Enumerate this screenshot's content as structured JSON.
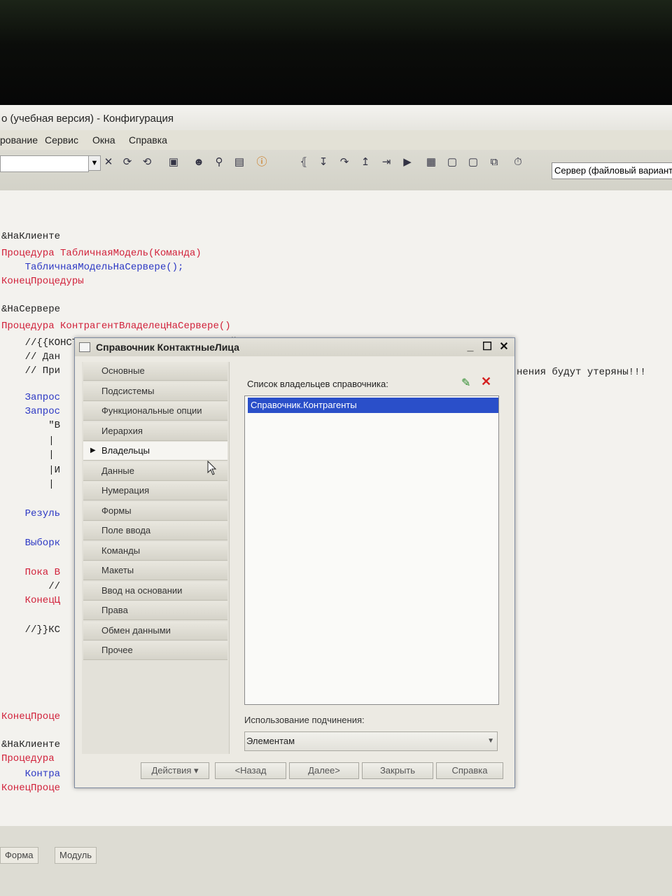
{
  "window": {
    "title": "о (учебная версия) - Конфигурация"
  },
  "menu": {
    "items": [
      "рование",
      "Сервис",
      "Окна",
      "Справка"
    ]
  },
  "toolbar": {
    "server_mode": "Сервер (файловый вариант"
  },
  "code": {
    "lines": [
      {
        "t": "&НаКлиенте",
        "c": "cm"
      },
      {
        "t": "Процедура ТабличнаяМодель(Команда)",
        "c": "kw"
      },
      {
        "t": "    ТабличнаяМодельНаСервере();",
        "c": "fn"
      },
      {
        "t": "КонецПроцедуры",
        "c": "kw"
      },
      {
        "t": "",
        "c": "cm"
      },
      {
        "t": "&НаСервере",
        "c": "cm"
      },
      {
        "t": "Процедура КонтрагентВладелецНаСервере()",
        "c": "kw"
      },
      {
        "t": "    //{{КОНСТРУКТОР_ЗАПРОСА_С_ОБРАБОТКОЙ_РЕЗУЛЬТАТА",
        "c": "cm"
      },
      {
        "t": "    // Дан",
        "c": "cm"
      },
      {
        "t": "    // При",
        "c": "cm"
      }
    ],
    "lines_right": "нения будут утеряны!!!",
    "partial_lines": [
      {
        "t": "    Запрос",
        "c": "fn"
      },
      {
        "t": "    Запрос",
        "c": "fn"
      },
      {
        "t": "        \"В",
        "c": "cm"
      },
      {
        "t": "        |",
        "c": "cm"
      },
      {
        "t": "        |",
        "c": "cm"
      },
      {
        "t": "        |И",
        "c": "cm"
      },
      {
        "t": "        |",
        "c": "cm"
      },
      {
        "t": "    Резуль",
        "c": "fn"
      },
      {
        "t": "    Выборк",
        "c": "fn"
      },
      {
        "t": "    Пока В",
        "c": "kw"
      },
      {
        "t": "        //",
        "c": "cm"
      },
      {
        "t": "    КонецЦ",
        "c": "kw"
      },
      {
        "t": "    //}}КС",
        "c": "cm"
      },
      {
        "t": "КонецПроце",
        "c": "kw"
      },
      {
        "t": "&НаКлиенте",
        "c": "cm"
      },
      {
        "t": "Процедура",
        "c": "kw"
      },
      {
        "t": "    Контра",
        "c": "fn"
      },
      {
        "t": "КонецПроце",
        "c": "kw"
      }
    ]
  },
  "dialog": {
    "title": "Справочник КонтактныеЛица",
    "nav": [
      "Основные",
      "Подсистемы",
      "Функциональные опции",
      "Иерархия",
      "Владельцы",
      "Данные",
      "Нумерация",
      "Формы",
      "Поле ввода",
      "Команды",
      "Макеты",
      "Ввод на основании",
      "Права",
      "Обмен данными",
      "Прочее"
    ],
    "active_nav": "Владельцы",
    "owners_label": "Список владельцев справочника:",
    "owners": [
      "Справочник.Контрагенты"
    ],
    "subordination_label": "Использование подчинения:",
    "subordination_value": "Элементам",
    "buttons": {
      "actions": "Действия",
      "back": "<Назад",
      "next": "Далее>",
      "close": "Закрыть",
      "help": "Справка"
    }
  },
  "bottom_tabs": {
    "form": "Форма",
    "module": "Модуль"
  }
}
